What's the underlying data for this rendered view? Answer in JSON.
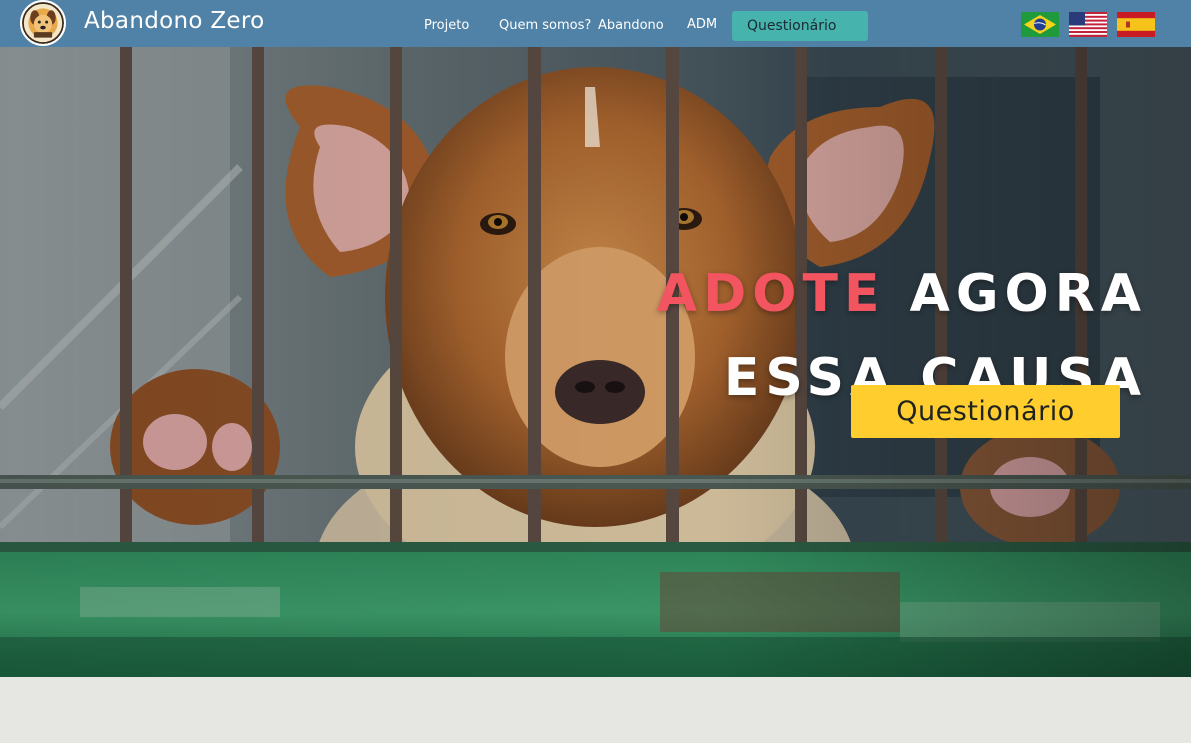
{
  "header": {
    "brand": "Abandono Zero",
    "nav": {
      "projeto": "Projeto",
      "quem_somos": "Quem somos?",
      "abandono": "Abandono",
      "adm": "ADM",
      "questionario": "Questionário"
    },
    "flags": [
      "brazil-flag-icon",
      "usa-flag-icon",
      "spain-flag-icon"
    ]
  },
  "hero": {
    "headline_accent": "ADOTE",
    "headline_line1_rest": " AGORA",
    "headline_line2": "ESSA CAUSA",
    "cta_label": "Questionário"
  },
  "colors": {
    "navbar": "#4f82a6",
    "nav_button": "#46b3ad",
    "accent_red": "#f2555f",
    "cta_yellow": "#ffcd2e",
    "page_background": "#e6e6e2"
  }
}
